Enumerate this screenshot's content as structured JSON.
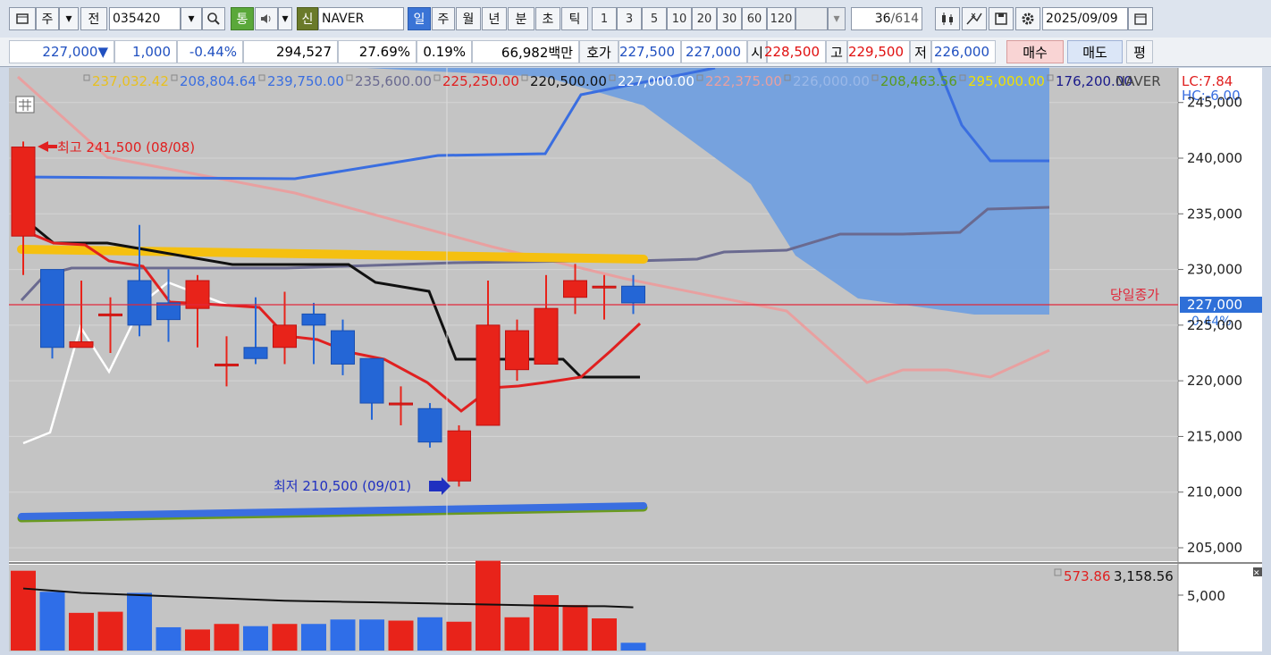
{
  "toolbar": {
    "type_label": "주",
    "prev_label": "전",
    "code_value": "035420",
    "tong_label": "통",
    "shin_label": "신",
    "name_value": "NAVER",
    "periods": [
      "일",
      "주",
      "월",
      "년",
      "분",
      "초",
      "틱"
    ],
    "minute_steps": [
      "1",
      "3",
      "5",
      "10",
      "20",
      "30",
      "60",
      "120"
    ],
    "count_value": "36",
    "count_total": "/614",
    "date_value": "2025/09/09"
  },
  "quote": {
    "price": "227,000▼",
    "change": "1,000",
    "change_pct": "-0.44%",
    "volume": "294,527",
    "ratio1": "27.69%",
    "ratio2": "0.19%",
    "amount": "66,982백만",
    "hoga_label": "호가",
    "ask": "227,500",
    "bid": "227,000",
    "open_label": "시",
    "open": "228,500",
    "high_label": "고",
    "high": "229,500",
    "low_label": "저",
    "low": "226,000",
    "buy_label": "매수",
    "sell_label": "매도",
    "eval_label": "평"
  },
  "legend": {
    "values": [
      "237,032.42",
      "208,804.64",
      "239,750.00",
      "235,600.00",
      "225,250.00",
      "220,500.00",
      "227,000.00",
      "222,375.00",
      "226,000.00",
      "208,463.56",
      "295,000.00",
      "176,200.00"
    ],
    "colors": [
      "#e8c020",
      "#3a6ee0",
      "#3a6ee0",
      "#6a6a90",
      "#e02020",
      "#111111",
      "#ffffff",
      "#e8a0a0",
      "#9ab8e8",
      "#5a9a20",
      "#f0e000",
      "#1a1a8a"
    ],
    "stock_name": "NAVER",
    "lc": "LC:7.84",
    "hc": "HC:-6.00"
  },
  "annotations": {
    "high_marker": "최고 241,500 (08/08)",
    "low_marker": "최저 210,500 (09/01)",
    "close_label": "당일종가",
    "close_price": "227,000",
    "close_pct": "-0.44%"
  },
  "volume_legend": {
    "v1": "573.86",
    "v2": "3,158.56",
    "tick": "5,000"
  },
  "chart_data": {
    "type": "candlestick",
    "title": "",
    "xlabel": "",
    "ylabel": "",
    "ylim": [
      203000,
      244000
    ],
    "yticks": [
      "205,000",
      "210,000",
      "215,000",
      "220,000",
      "225,000",
      "230,000",
      "235,000",
      "240,000",
      "245,000"
    ],
    "candles": [
      {
        "o": 233000,
        "h": 241500,
        "l": 229500,
        "c": 241000
      },
      {
        "o": 230000,
        "h": 230000,
        "l": 222000,
        "c": 223000
      },
      {
        "o": 223000,
        "h": 229000,
        "l": 223000,
        "c": 223500
      },
      {
        "o": 226000,
        "h": 227500,
        "l": 222500,
        "c": 226000
      },
      {
        "o": 229000,
        "h": 234000,
        "l": 224000,
        "c": 225000
      },
      {
        "o": 227000,
        "h": 230000,
        "l": 223500,
        "c": 225500
      },
      {
        "o": 226500,
        "h": 229500,
        "l": 223000,
        "c": 229000
      },
      {
        "o": 221500,
        "h": 224000,
        "l": 219500,
        "c": 221500
      },
      {
        "o": 223000,
        "h": 227500,
        "l": 221500,
        "c": 222000
      },
      {
        "o": 223000,
        "h": 228000,
        "l": 221500,
        "c": 225000
      },
      {
        "o": 226000,
        "h": 227000,
        "l": 221500,
        "c": 225000
      },
      {
        "o": 224500,
        "h": 225500,
        "l": 220500,
        "c": 221500
      },
      {
        "o": 222000,
        "h": 222000,
        "l": 216500,
        "c": 218000
      },
      {
        "o": 218000,
        "h": 219500,
        "l": 216000,
        "c": 218000
      },
      {
        "o": 217500,
        "h": 218000,
        "l": 214000,
        "c": 214500
      },
      {
        "o": 211000,
        "h": 216000,
        "l": 210500,
        "c": 215500
      },
      {
        "o": 216000,
        "h": 229000,
        "l": 216000,
        "c": 225000
      },
      {
        "o": 221000,
        "h": 225500,
        "l": 220000,
        "c": 224500
      },
      {
        "o": 221500,
        "h": 229500,
        "l": 221500,
        "c": 226500
      },
      {
        "o": 227500,
        "h": 230500,
        "l": 226000,
        "c": 229000
      },
      {
        "o": 228500,
        "h": 229500,
        "l": 225500,
        "c": 228500
      },
      {
        "o": 228500,
        "h": 229500,
        "l": 226000,
        "c": 227000
      }
    ],
    "volume": [
      7200,
      5300,
      3400,
      3500,
      5200,
      2100,
      1900,
      2400,
      2200,
      2400,
      2400,
      2800,
      2800,
      2700,
      3000,
      2600,
      8100,
      3000,
      5000,
      4100,
      2900,
      700
    ],
    "volume_ma": [
      5600,
      5400,
      5200,
      5100,
      5000,
      4900,
      4800,
      4700,
      4600,
      4500,
      4450,
      4400,
      4350,
      4300,
      4250,
      4200,
      4150,
      4100,
      4050,
      4000,
      4000,
      3900
    ]
  }
}
